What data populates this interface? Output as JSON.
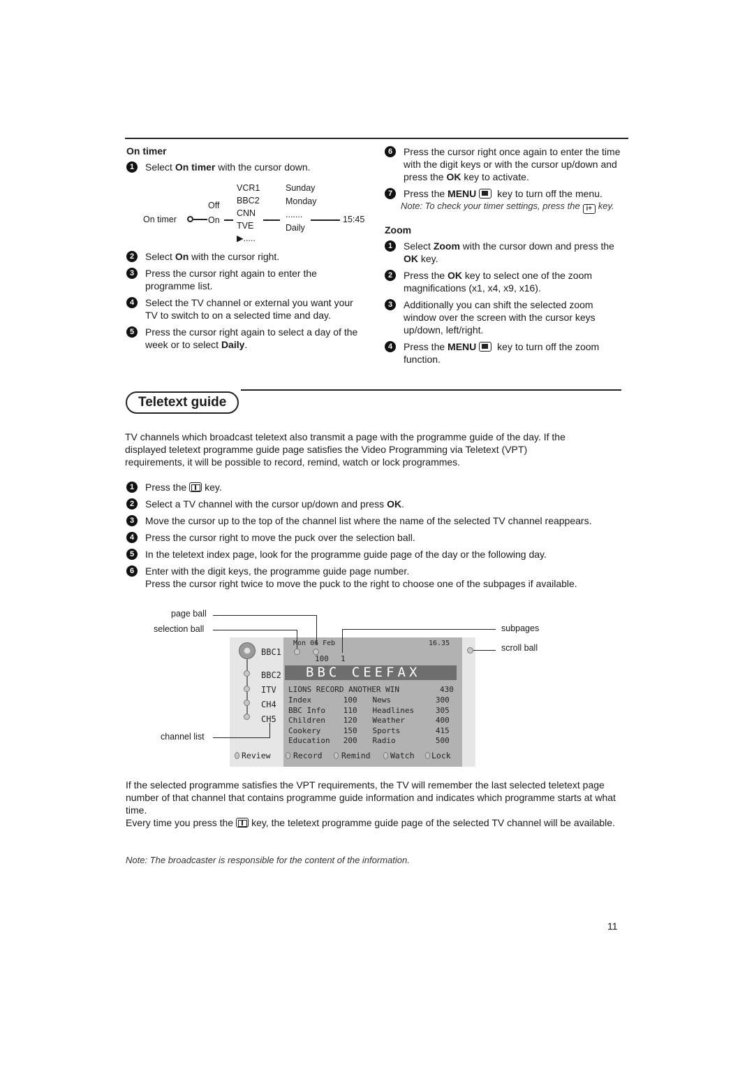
{
  "on_timer": {
    "heading": "On timer",
    "steps": [
      {
        "num": "1",
        "pre": "Select ",
        "bold": "On timer",
        "post": " with the cursor down."
      },
      {
        "num": "2",
        "pre": "Select ",
        "bold": "On",
        "post": " with the cursor right."
      },
      {
        "num": "3",
        "text": "Press the cursor right again to enter the programme list."
      },
      {
        "num": "4",
        "text": "Select the TV channel or external you want your TV to switch to on a selected time and day."
      },
      {
        "num": "5",
        "pre": "Press the cursor right again to select a day of the week or to select ",
        "bold": "Daily",
        "post": "."
      },
      {
        "num": "6",
        "pre": "Press the cursor right once again to enter the time with the digit keys or with the cursor up/down and press the ",
        "bold": "OK",
        "post": " key to activate."
      },
      {
        "num": "7",
        "pre": "Press the ",
        "bold": "MENU",
        "post": " key to turn off the menu."
      }
    ],
    "note_pre": "Note: To check your timer settings, press the",
    "note_post": "key.",
    "info_key": "i+",
    "diagram": {
      "root": "On timer",
      "off": "Off",
      "on": "On",
      "channels": [
        "VCR1",
        "BBC2",
        "CNN",
        "TVE",
        "▶....."
      ],
      "days": [
        "Sunday",
        "Monday",
        ".......",
        "Daily"
      ],
      "time": "15:45"
    }
  },
  "zoom": {
    "heading": "Zoom",
    "steps": [
      {
        "num": "1",
        "pre": "Select ",
        "bold": "Zoom",
        "mid": " with the cursor down and press the ",
        "bold2": "OK",
        "post": " key."
      },
      {
        "num": "2",
        "pre": "Press the ",
        "bold": "OK",
        "post": " key to select one of the zoom magnifications (x1, x4, x9, x16)."
      },
      {
        "num": "3",
        "text": "Additionally you can shift the selected zoom window over the screen with the cursor keys up/down, left/right."
      },
      {
        "num": "4",
        "pre": "Press the ",
        "bold": "MENU",
        "post": " key to turn off the zoom function."
      }
    ]
  },
  "teletext_guide": {
    "title": "Teletext guide",
    "intro": "TV channels which broadcast teletext also transmit a page with the programme guide of the day. If the displayed teletext programme guide page satisfies the Video Programming via Teletext (VPT) requirements, it will be possible to record, remind, watch or lock programmes.",
    "steps": [
      {
        "num": "1",
        "pre": "Press the",
        "post": "key."
      },
      {
        "num": "2",
        "pre": "Select a TV channel with the cursor up/down and press ",
        "bold": "OK",
        "post": "."
      },
      {
        "num": "3",
        "text": "Move the cursor up to the top of the channel list where the name of the selected TV channel reappears."
      },
      {
        "num": "4",
        "text": "Press the cursor right to move the puck over the selection ball."
      },
      {
        "num": "5",
        "text": "In the teletext index page, look for the programme guide page of the day or the following day."
      },
      {
        "num": "6",
        "text": "Enter with the digit keys, the programme guide page number.",
        "text2": "Press the cursor right twice to move the puck to the right to choose one of the subpages if available."
      }
    ],
    "callouts": {
      "page_ball": "page ball",
      "selection_ball": "selection ball",
      "channel_list": "channel list",
      "subpages": "subpages",
      "scroll_ball": "scroll ball"
    },
    "screen": {
      "date": "Mon 06 Feb",
      "time": "16.35",
      "page": "100",
      "subpage": "1",
      "banner": "BBC CEEFAX",
      "headline": "LIONS RECORD ANOTHER WIN",
      "headline_page": "430",
      "channels": [
        "BBC1",
        "BBC2",
        "ITV",
        "CH4",
        "CH5"
      ],
      "index_left": [
        {
          "name": "Index",
          "page": "100"
        },
        {
          "name": "BBC Info",
          "page": "110"
        },
        {
          "name": "Children",
          "page": "120"
        },
        {
          "name": "Cookery",
          "page": "150"
        },
        {
          "name": "Education",
          "page": "200"
        }
      ],
      "index_right": [
        {
          "name": "News",
          "page": "300"
        },
        {
          "name": "Headlines",
          "page": "305"
        },
        {
          "name": "Weather",
          "page": "400"
        },
        {
          "name": "Sports",
          "page": "415"
        },
        {
          "name": "Radio",
          "page": "500"
        }
      ],
      "buttons": [
        "Review",
        "Record",
        "Remind",
        "Watch",
        "Lock"
      ]
    },
    "after1": "If the selected programme satisfies the VPT requirements, the TV will remember the last selected teletext page number of that channel that contains programme guide information and indicates which programme starts at what time.",
    "after2_pre": "Every time you press the",
    "after2_post": "key, the teletext programme guide page of the selected TV channel will be available.",
    "note": "Note: The broadcaster is responsible for the content of the information."
  },
  "page_number": "11"
}
